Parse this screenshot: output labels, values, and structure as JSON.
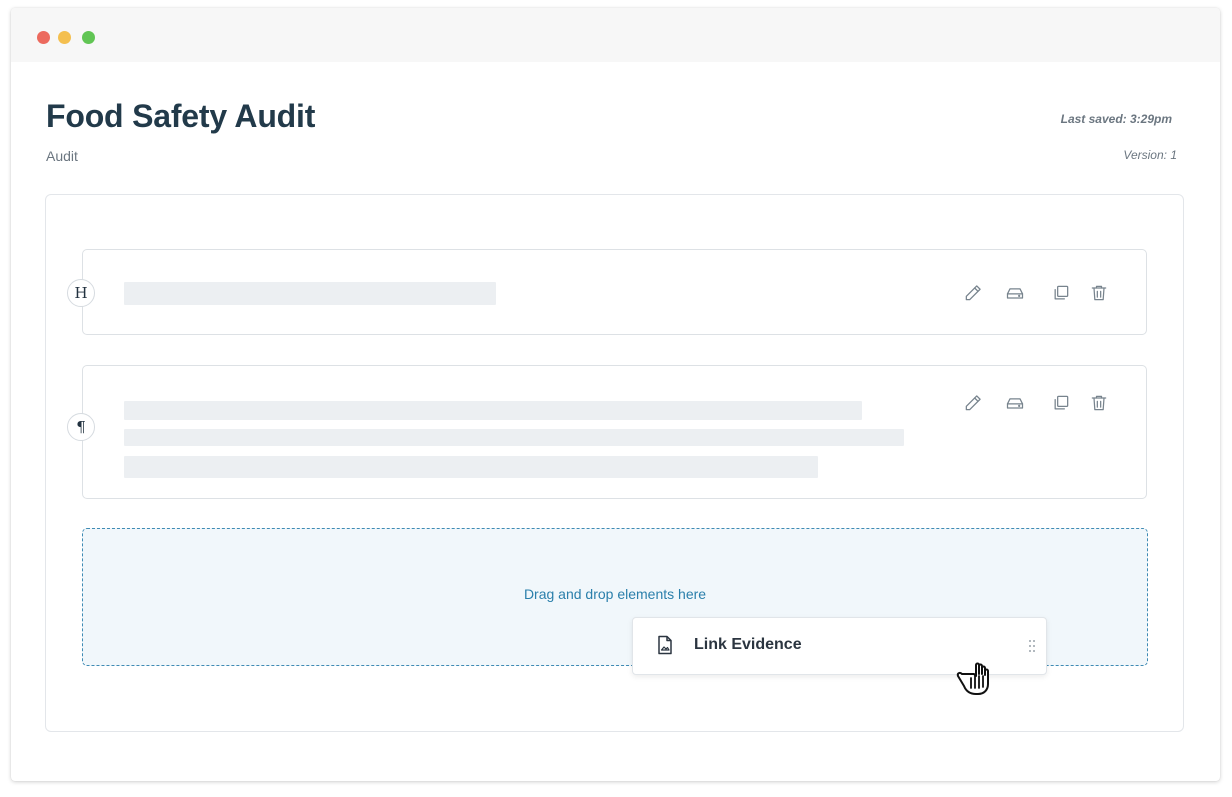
{
  "header": {
    "title": "Food Safety Audit",
    "subtitle": "Audit",
    "last_saved": "Last saved: 3:29pm",
    "version": "Version: 1"
  },
  "blocks": [
    {
      "type": "heading",
      "badge": "H",
      "icons": [
        "pencil-icon",
        "archive-icon",
        "duplicate-icon",
        "trash-icon"
      ]
    },
    {
      "type": "paragraph",
      "badge": "¶",
      "icons": [
        "pencil-icon",
        "archive-icon",
        "duplicate-icon",
        "trash-icon"
      ]
    }
  ],
  "dropzone": {
    "text": "Drag and drop elements here"
  },
  "drag_item": {
    "label": "Link Evidence",
    "icon": "file-image-icon",
    "handle_icon": "drag-handle-icon"
  },
  "cursor": "grab-hand-cursor-icon",
  "colors": {
    "title": "#223a4a",
    "accent": "#2a7fab",
    "dropzone_bg": "#f1f7fb",
    "dropzone_border": "#3f8bb4",
    "skeleton": "#eceff2"
  }
}
